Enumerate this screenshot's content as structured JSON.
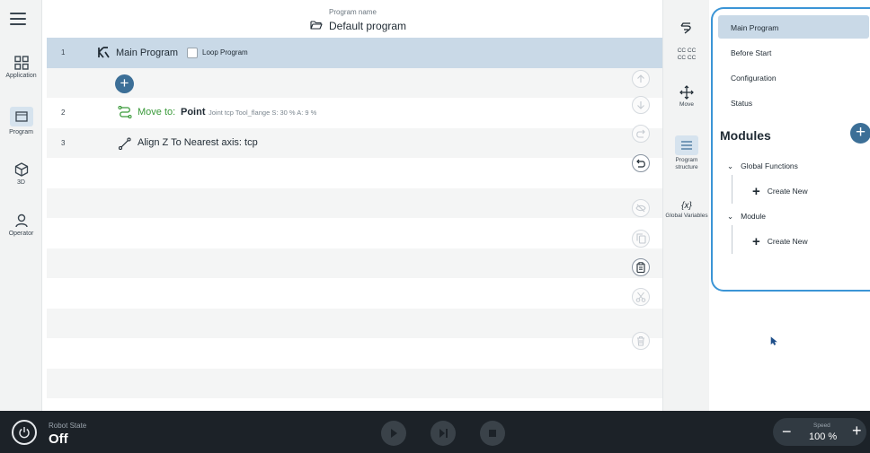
{
  "nav": {
    "items": [
      {
        "label": "Application",
        "icon": "grid-icon"
      },
      {
        "label": "Program",
        "icon": "program-icon"
      },
      {
        "label": "3D",
        "icon": "cube-icon"
      },
      {
        "label": "Operator",
        "icon": "person-icon"
      }
    ]
  },
  "header": {
    "caption": "Program name",
    "program_name": "Default program"
  },
  "rows": {
    "main": {
      "num": "1",
      "label": "Main Program",
      "loop_label": "Loop Program"
    },
    "move": {
      "num": "2",
      "label": "Move to:",
      "point": "Point",
      "params": "Joint  tcp  Tool_flange  S: 30 %  A: 9 %"
    },
    "align": {
      "num": "3",
      "label": "Align Z To Nearest axis:  tcp"
    }
  },
  "tools": {
    "cc_label": "CC CC\nCC CC",
    "move": "Move",
    "program_structure": "Program structure",
    "global_variables": "Global Variables",
    "var_glyph": "{x}"
  },
  "panel": {
    "items": [
      "Main Program",
      "Before Start",
      "Configuration",
      "Status"
    ],
    "modules_title": "Modules",
    "groups": [
      {
        "label": "Global Functions",
        "create": "Create New"
      },
      {
        "label": "Module",
        "create": "Create New"
      }
    ]
  },
  "bottom": {
    "robot_state_caption": "Robot State",
    "robot_state": "Off",
    "speed_caption": "Speed",
    "speed_value": "100 %"
  },
  "colors": {
    "accent": "#3c6f97",
    "selection": "#c9d9e7",
    "panel_border": "#3b95d6",
    "move_green": "#3a9a3a",
    "bottombar": "#1c2228"
  }
}
